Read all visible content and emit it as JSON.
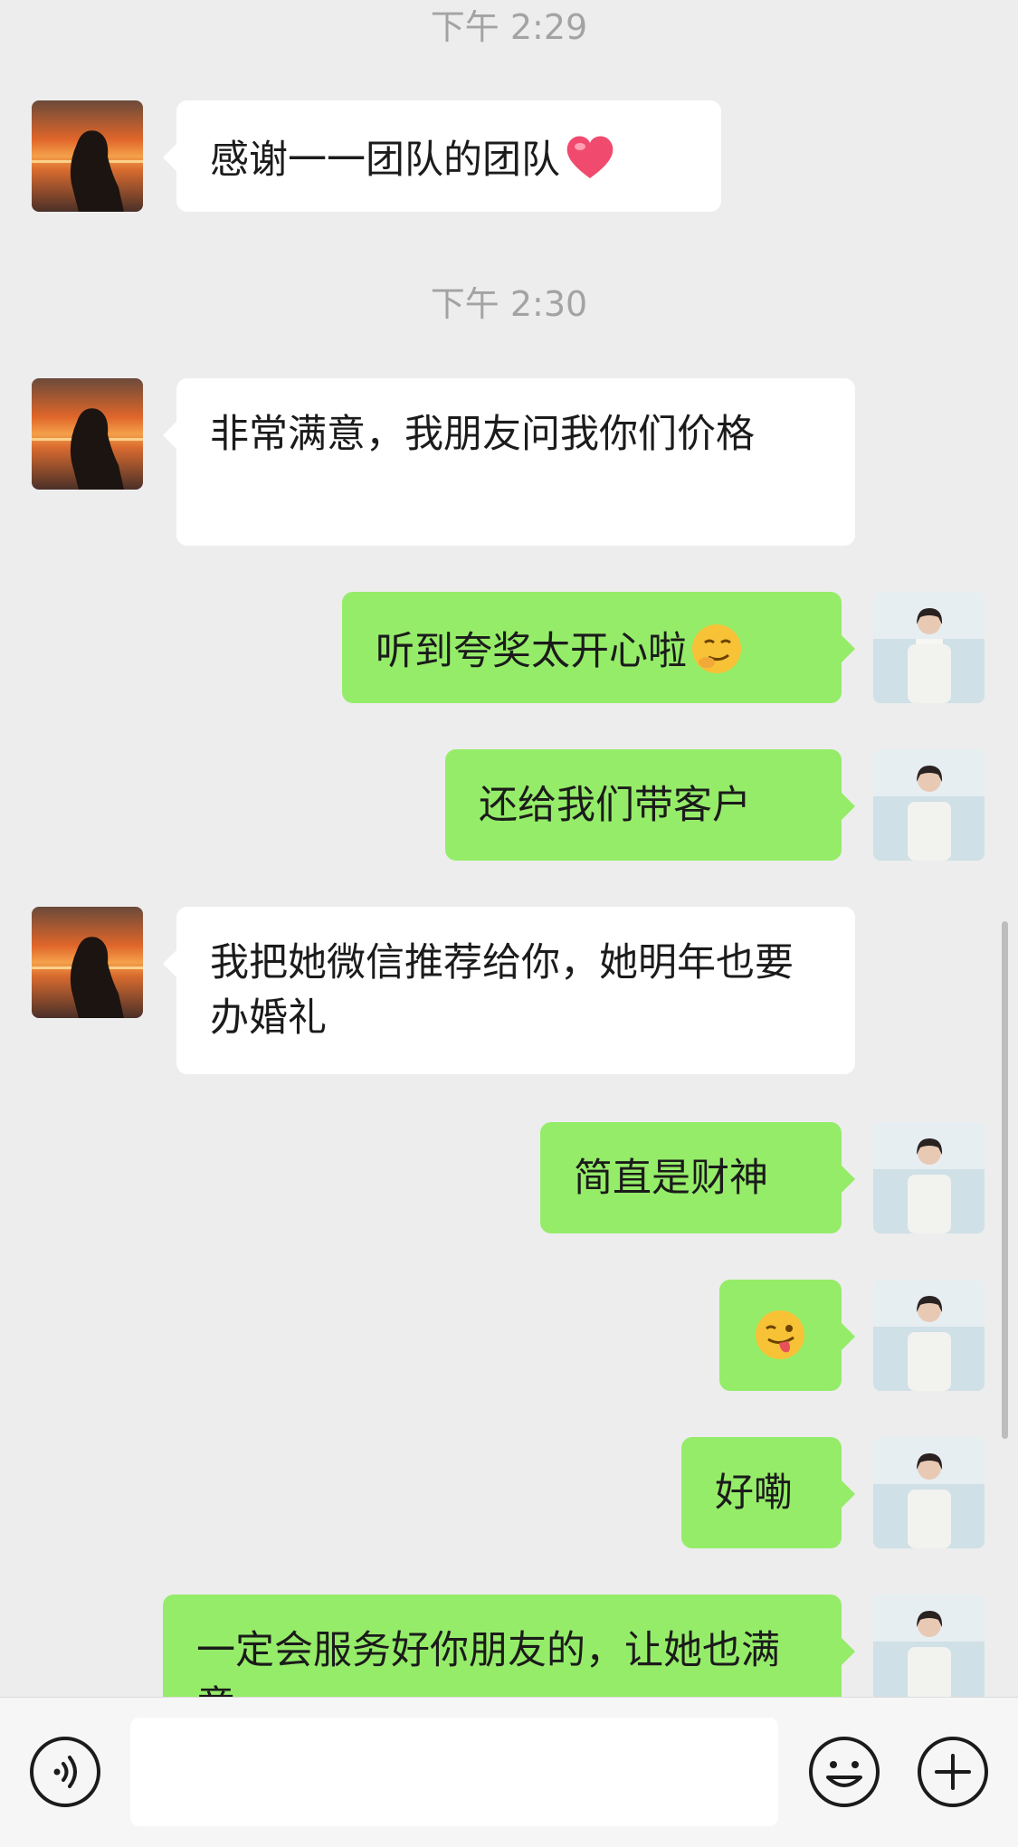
{
  "timestamps": [
    "下午 2:29",
    "下午 2:30"
  ],
  "messages": [
    {
      "side": "left",
      "text": "感谢一一团队的团队",
      "emoji": "heart"
    },
    {
      "side": "left",
      "text": "非常满意，我朋友问我你们价格"
    },
    {
      "side": "right",
      "text": "听到夸奖太开心啦",
      "emoji": "smirk-face"
    },
    {
      "side": "right",
      "text": "还给我们带客户"
    },
    {
      "side": "left",
      "text": "我把她微信推荐给你，她明年也要办婚礼"
    },
    {
      "side": "right",
      "text": "简直是财神"
    },
    {
      "side": "right",
      "text": "",
      "emoji": "winking-tongue-face"
    },
    {
      "side": "right",
      "text": "好嘞"
    },
    {
      "side": "right",
      "text": "一定会服务好你朋友的，让她也满意"
    }
  ],
  "avatars": {
    "left": "sunset-silhouette-avatar",
    "right": "beach-portrait-avatar"
  },
  "input_bar": {
    "value": "",
    "placeholder": "",
    "voice_icon": "voice-icon",
    "emoji_icon": "emoji-icon",
    "plus_icon": "plus-icon"
  },
  "colors": {
    "background": "#ededed",
    "bubble_in": "#ffffff",
    "bubble_out": "#95ec69",
    "timestamp": "#a3a3a3"
  }
}
